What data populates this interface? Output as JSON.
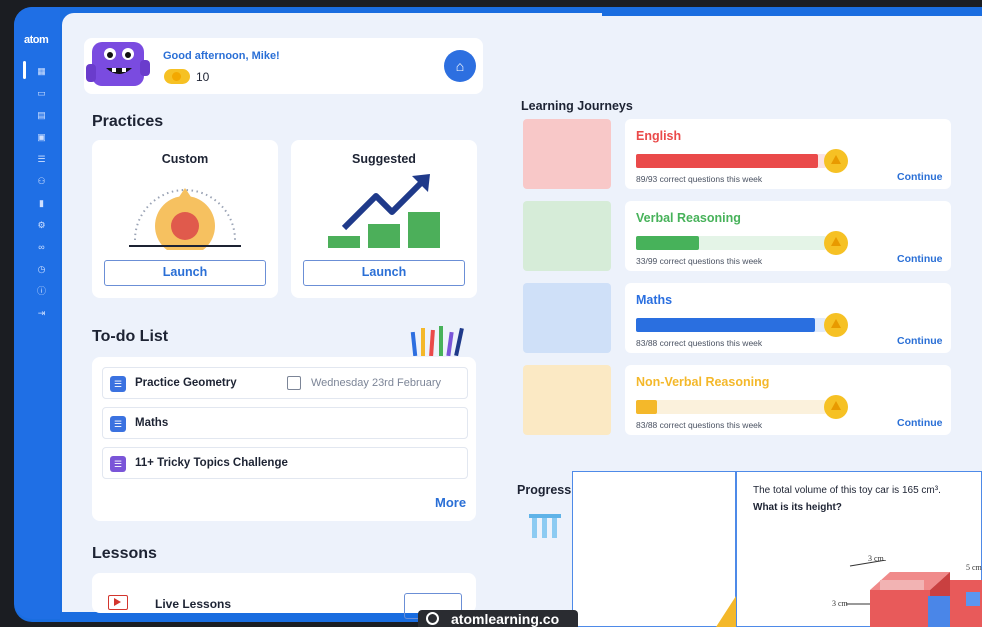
{
  "app": {
    "logo": "atom"
  },
  "sidebar": {
    "icons": [
      "dashboard-icon",
      "video-icon",
      "book-icon",
      "calculator-icon",
      "list-icon",
      "people-icon",
      "chart-icon",
      "settings-icon",
      "link-icon",
      "clock-icon",
      "info-icon",
      "logout-icon"
    ]
  },
  "greeting": {
    "text": "Good afternoon, Mike!",
    "coins": "10"
  },
  "practices": {
    "title": "Practices",
    "custom": {
      "label": "Custom",
      "button": "Launch"
    },
    "suggested": {
      "label": "Suggested",
      "button": "Launch"
    }
  },
  "todo": {
    "title": "To-do List",
    "items": [
      {
        "label": "Practice Geometry",
        "date": "Wednesday 23rd February"
      },
      {
        "label": "Maths"
      },
      {
        "label": "11+ Tricky Topics Challenge"
      }
    ],
    "more": "More"
  },
  "lessons": {
    "title": "Lessons",
    "item": "Live Lessons"
  },
  "journeys": {
    "title": "Learning Journeys",
    "items": [
      {
        "name": "English",
        "stat": "89/93 correct questions this week",
        "progress": 0.957,
        "color": "#ea4a4a",
        "track": "#fbe3e3",
        "img_bg": "#f8c8c8",
        "continue": "Continue"
      },
      {
        "name": "Verbal Reasoning",
        "stat": "33/99 correct questions this week",
        "progress": 0.333,
        "color": "#47b25a",
        "track": "#e4f4e7",
        "img_bg": "#d6ecd8",
        "continue": "Continue"
      },
      {
        "name": "Maths",
        "stat": "83/88 correct questions this week",
        "progress": 0.943,
        "color": "#2a6fe0",
        "track": "#e1ebfb",
        "img_bg": "#cfe0f8",
        "continue": "Continue"
      },
      {
        "name": "Non-Verbal Reasoning",
        "stat": "83/88 correct questions this week",
        "progress": 0.11,
        "color": "#f4b82a",
        "track": "#fbf1dc",
        "img_bg": "#fbe9c4",
        "continue": "Continue"
      }
    ]
  },
  "progress": {
    "title": "Progress"
  },
  "question": {
    "text": "The total volume of this toy car is 165 cm³.",
    "prompt": "What is its height?",
    "dims": [
      "3 cm",
      "5 cm",
      "3 cm"
    ]
  },
  "watermark": {
    "text": "atomlearning.co"
  }
}
